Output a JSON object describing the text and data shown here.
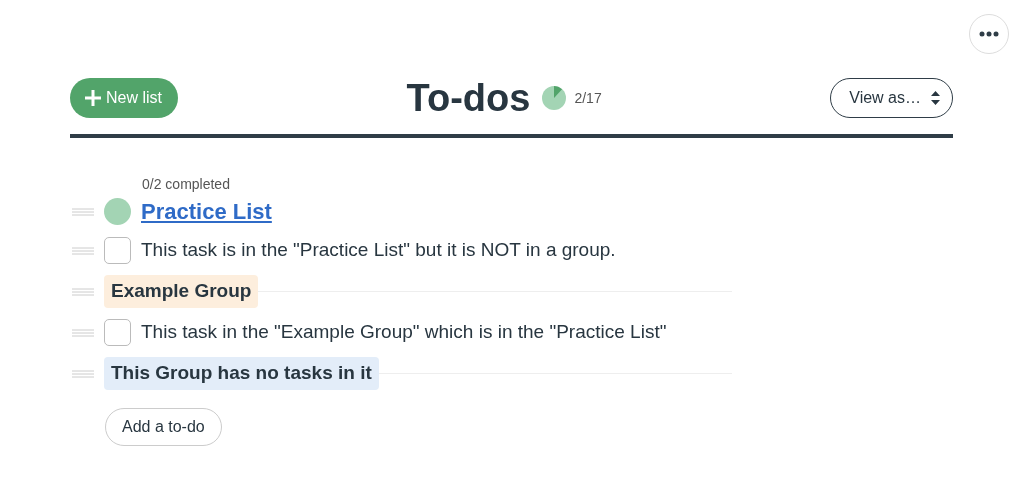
{
  "header": {
    "new_list_button": "New list",
    "title": "To-dos",
    "progress": {
      "count": "2/17"
    },
    "view_select": "View as…"
  },
  "list": {
    "completed": "0/2 completed",
    "title": "Practice List",
    "color": "#a3d4b4",
    "items": [
      {
        "kind": "task",
        "text": "This task is in the \"Practice List\" but it is NOT in a group.",
        "checked": false
      },
      {
        "kind": "group",
        "text": "Example Group",
        "color": "#fdeedd"
      },
      {
        "kind": "task",
        "text": "This task in the \"Example Group\" which is in the \"Practice List\"",
        "checked": false
      },
      {
        "kind": "group",
        "text": "This Group has no tasks in it",
        "color": "#e3edf9"
      }
    ],
    "add_button": "Add a to-do"
  }
}
